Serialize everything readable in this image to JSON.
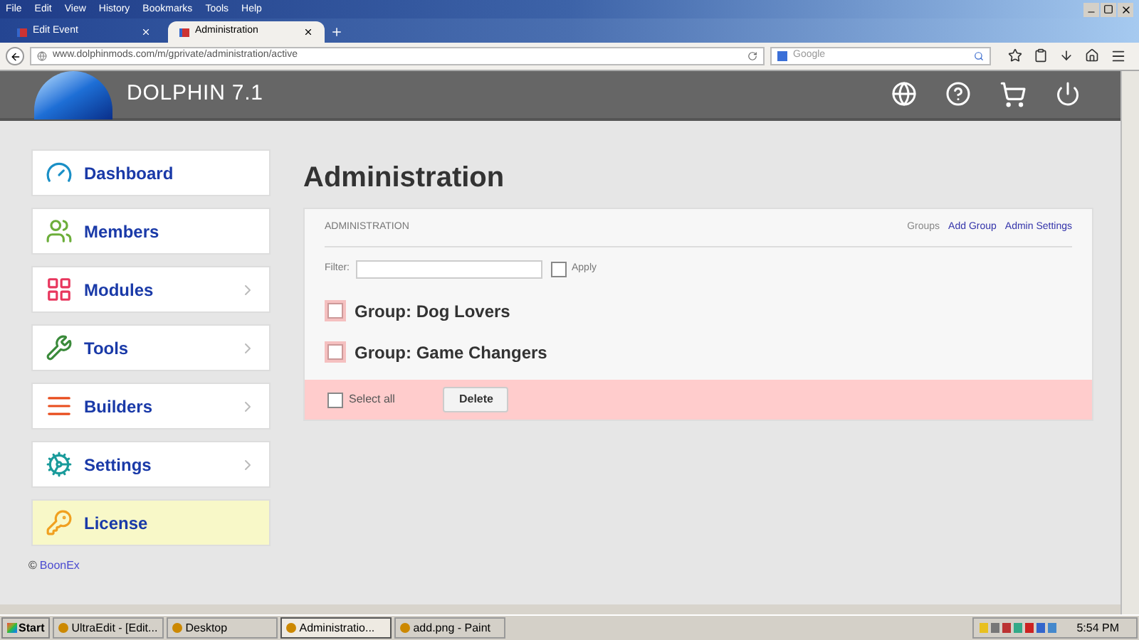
{
  "browser": {
    "menu": [
      "File",
      "Edit",
      "View",
      "History",
      "Bookmarks",
      "Tools",
      "Help"
    ],
    "tabs": [
      {
        "label": "Edit Event",
        "selected": false
      },
      {
        "label": "Administration",
        "selected": true
      }
    ],
    "url": "www.dolphinmods.com/m/gprivate/administration/active",
    "search": {
      "placeholder": "Google"
    }
  },
  "header": {
    "title": "DOLPHIN 7.1"
  },
  "sidebar": {
    "items": [
      {
        "label": "Dashboard",
        "kind": "link",
        "selected": false
      },
      {
        "label": "Members",
        "kind": "link",
        "selected": false
      },
      {
        "label": "Modules",
        "kind": "submenu",
        "selected": false
      },
      {
        "label": "Tools",
        "kind": "submenu",
        "selected": false
      },
      {
        "label": "Builders",
        "kind": "submenu",
        "selected": false
      },
      {
        "label": "Settings",
        "kind": "submenu",
        "selected": false
      },
      {
        "label": "License",
        "kind": "link",
        "selected": true
      }
    ],
    "copyright": {
      "symbol": "©",
      "link": "BoonEx"
    }
  },
  "page_title": "Administration",
  "panel": {
    "heading": "ADMINISTRATION",
    "links": [
      {
        "label": "Groups",
        "selected": true
      },
      {
        "label": "Add Group",
        "selected": false
      },
      {
        "label": "Admin Settings",
        "selected": false
      }
    ],
    "filter": {
      "label": "Filter:",
      "apply": "Apply",
      "checked": false
    },
    "groups": [
      {
        "label": "Group: Dog Lovers",
        "checked": false
      },
      {
        "label": "Group: Game Changers",
        "checked": false
      }
    ],
    "footer": {
      "select_all": "Select all",
      "checked": false,
      "button": "Delete"
    }
  },
  "taskbar": {
    "start": "Start",
    "items": [
      {
        "label": "UltraEdit - [Edit...",
        "selected": false
      },
      {
        "label": "Desktop",
        "selected": false
      },
      {
        "label": "Administratio...",
        "selected": true
      },
      {
        "label": "add.png - Paint",
        "selected": false
      }
    ],
    "clock": "5:54 PM"
  }
}
